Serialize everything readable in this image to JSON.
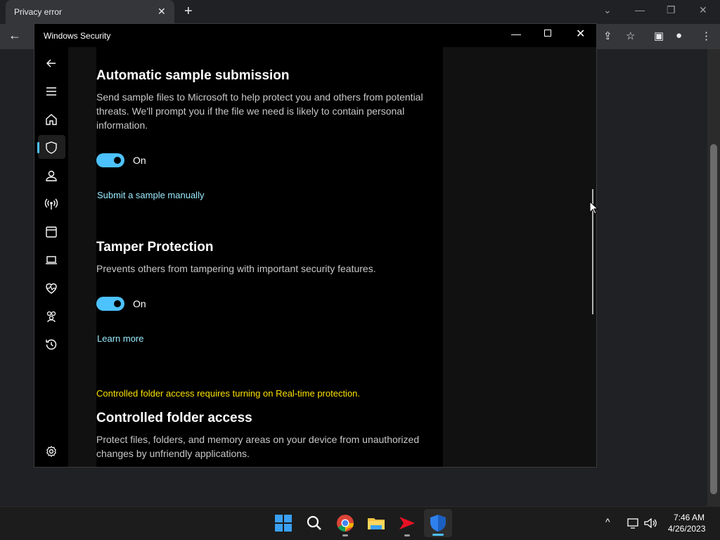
{
  "browser": {
    "tab_title": "Privacy error",
    "tab_close": "✕",
    "new_tab": "+"
  },
  "window": {
    "title": "Windows Security",
    "minimize": "—",
    "close": "✕"
  },
  "sections": {
    "auto_sample": {
      "heading": "Automatic sample submission",
      "description": "Send sample files to Microsoft to help protect you and others from potential threats. We'll prompt you if the file we need is likely to contain personal information.",
      "toggle_state": "On",
      "link": "Submit a sample manually"
    },
    "tamper": {
      "heading": "Tamper Protection",
      "description": "Prevents others from tampering with important security features.",
      "toggle_state": "On",
      "link": "Learn more"
    },
    "cfa": {
      "warning": "Controlled folder access requires turning on Real-time protection.",
      "heading": "Controlled folder access",
      "description": "Protect files, folders, and memory areas on your device from unauthorized changes by unfriendly applications."
    }
  },
  "taskbar": {
    "time": "7:46 AM",
    "date": "4/26/2023",
    "tray_chevron": "^"
  },
  "colors": {
    "accent": "#4cc2ff",
    "link": "#99ebff",
    "warning": "#fce100"
  }
}
